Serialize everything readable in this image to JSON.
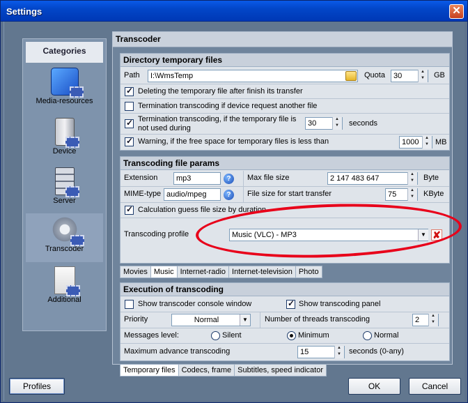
{
  "window": {
    "title": "Settings",
    "close_glyph": "✕"
  },
  "categories": {
    "header": "Categories",
    "items": [
      {
        "label": "Media-resources",
        "icon": "media-resources-icon"
      },
      {
        "label": "Device",
        "icon": "device-icon"
      },
      {
        "label": "Server",
        "icon": "server-icon"
      },
      {
        "label": "Transcoder",
        "icon": "transcoder-icon",
        "selected": true
      },
      {
        "label": "Additional",
        "icon": "additional-icon"
      }
    ]
  },
  "panel": {
    "title": "Transcoder"
  },
  "dir_group": {
    "title": "Directory temporary files",
    "path_label": "Path",
    "path_value": "I:\\WmsTemp",
    "quota_label": "Quota",
    "quota_value": "30",
    "quota_unit": "GB",
    "opt_delete": {
      "label": "Deleting the temporary file after finish its transfer",
      "checked": true
    },
    "opt_terminate_request": {
      "label": "Termination transcoding if device request another file",
      "checked": false
    },
    "opt_terminate_unused": {
      "label_1": "Termination transcoding, if the temporary file is",
      "label_2": "not used during",
      "value": "30",
      "unit": "seconds",
      "checked": true
    },
    "opt_warning": {
      "label": "Warning, if the free space for temporary files is less than",
      "value": "1000",
      "unit": "MB",
      "checked": true
    }
  },
  "params_group": {
    "title": "Transcoding file params",
    "extension_label": "Extension",
    "extension_value": "mp3",
    "mime_label": "MIME-type",
    "mime_value": "audio/mpeg",
    "max_size_label": "Max file size",
    "max_size_value": "2 147 483 647",
    "max_size_unit": "Byte",
    "start_size_label": "File size for start transfer",
    "start_size_value": "75",
    "start_size_unit": "KByte",
    "calc_guess": {
      "label": "Calculation guess file size by duration",
      "checked": true
    },
    "profile_label": "Transcoding profile",
    "profile_value": "Music (VLC) - MP3"
  },
  "type_tabs": [
    "Movies",
    "Music",
    "Internet-radio",
    "Internet-television",
    "Photo"
  ],
  "exec_group": {
    "title": "Execution of transcoding",
    "console": {
      "label": "Show transcoder console window",
      "checked": false
    },
    "panel_opt": {
      "label": "Show transcoding panel",
      "checked": true
    },
    "priority_label": "Priority",
    "priority_value": "Normal",
    "threads_label": "Number of threads transcoding",
    "threads_value": "2",
    "messages_label": "Messages level:",
    "msg_silent": "Silent",
    "msg_minimum": "Minimum",
    "msg_normal": "Normal",
    "advance_label": "Maximum advance transcoding",
    "advance_value": "15",
    "advance_unit": "seconds (0-any)"
  },
  "bottom_tabs": [
    "Temporary files",
    "Codecs, frame",
    "Subtitles, speed indicator"
  ],
  "footer": {
    "profiles": "Profiles",
    "ok": "OK",
    "cancel": "Cancel"
  },
  "colors": {
    "annotation": "#e8001a",
    "titlebar": "#0246c8"
  }
}
